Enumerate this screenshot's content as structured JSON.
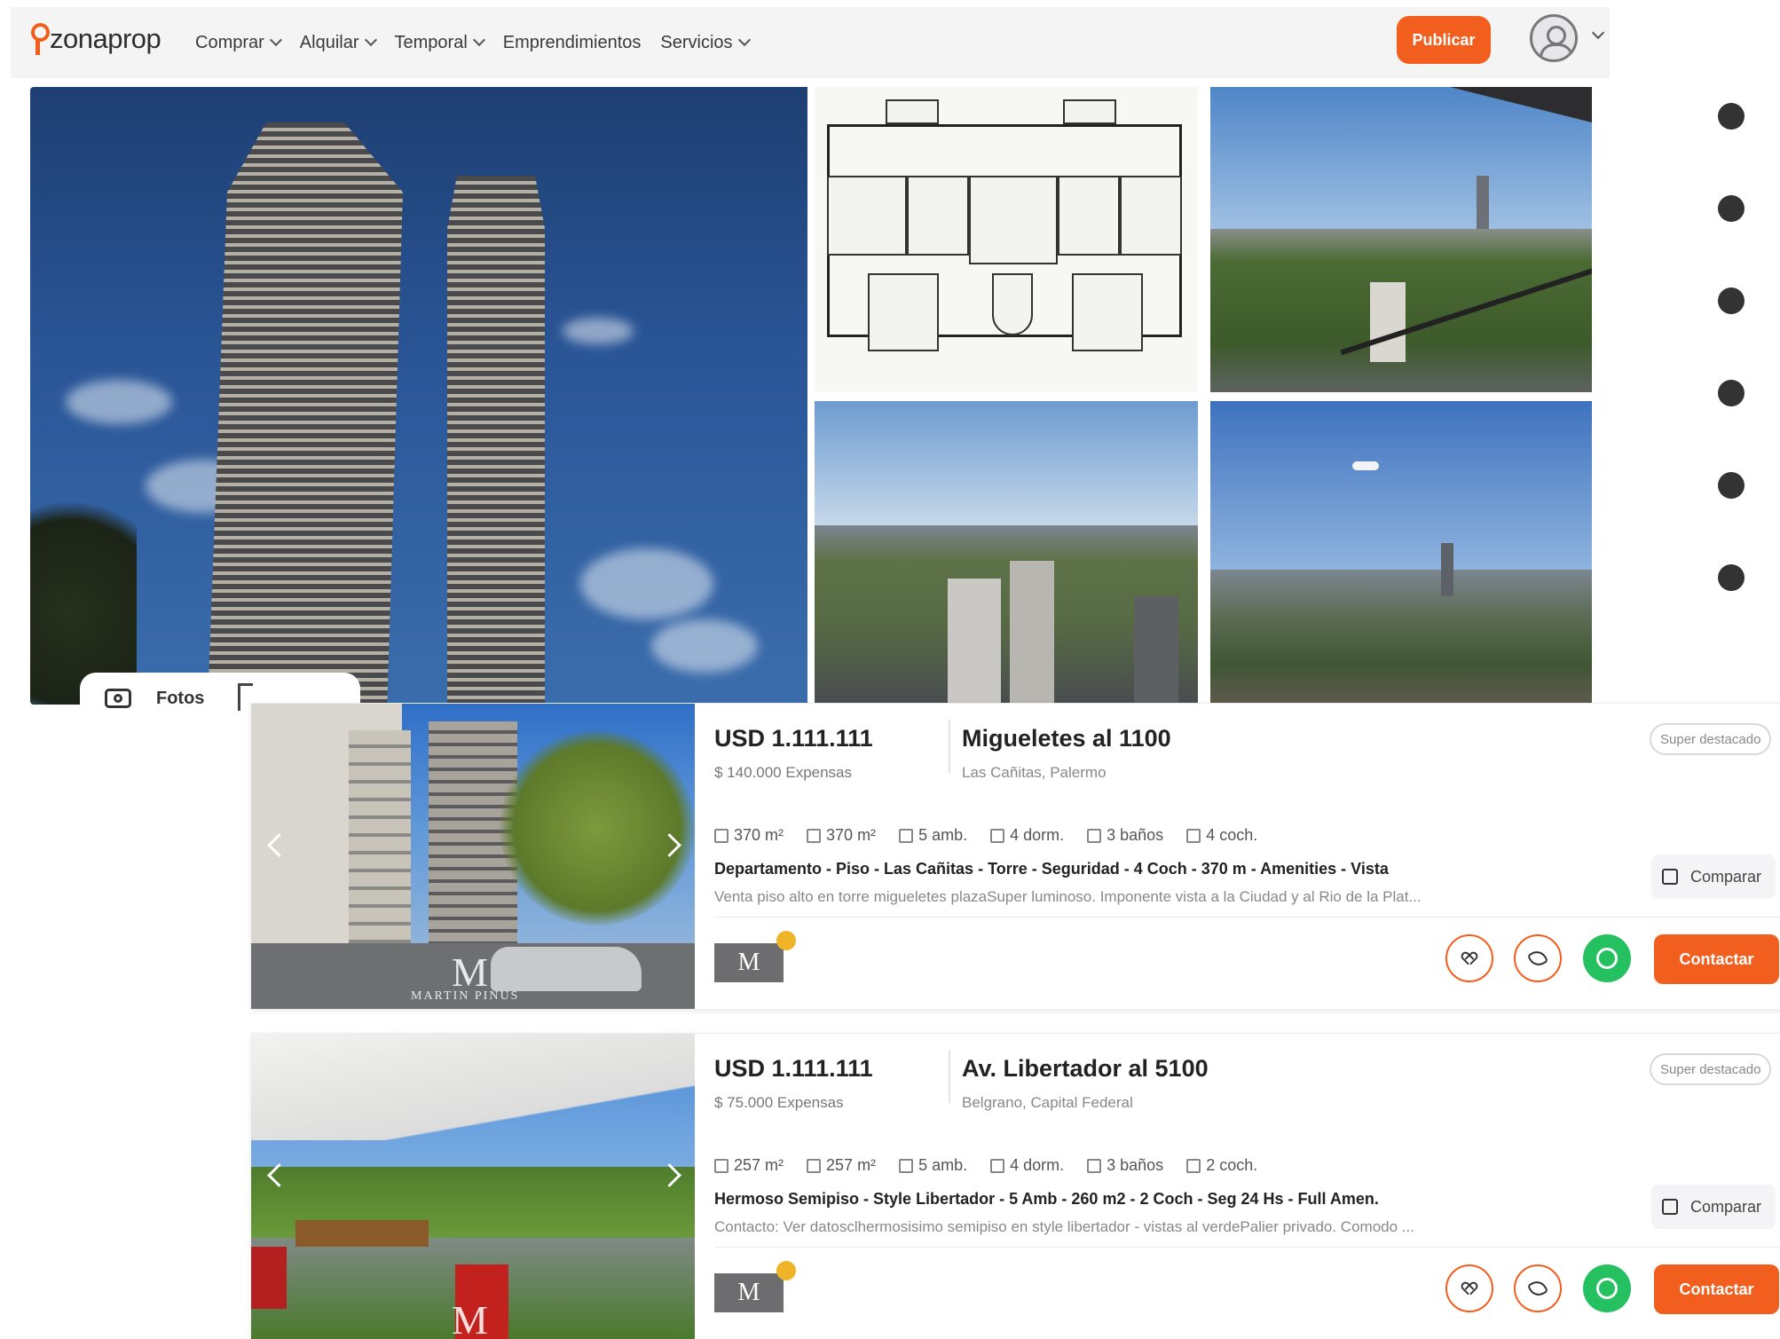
{
  "header": {
    "logo_text": "zonaprop",
    "nav": [
      {
        "label": "Comprar",
        "has_dropdown": true
      },
      {
        "label": "Alquilar",
        "has_dropdown": true
      },
      {
        "label": "Temporal",
        "has_dropdown": true
      },
      {
        "label": "Emprendimientos",
        "has_dropdown": false
      },
      {
        "label": "Servicios",
        "has_dropdown": true
      }
    ],
    "publish_label": "Publicar"
  },
  "gallery": {
    "photos_label": "Fotos",
    "dots_count": 6
  },
  "listings": [
    {
      "price": "USD 1.111.111",
      "expenses": "$ 140.000 Expensas",
      "address": "Migueletes al 1100",
      "location": "Las Cañitas, Palermo",
      "badge": "Super destacado",
      "features": [
        "370 m²",
        "370 m²",
        "5 amb.",
        "4 dorm.",
        "3 baños",
        "4 coch."
      ],
      "headline": "Departamento - Piso - Las Cañitas - Torre - Seguridad - 4 Coch - 370 m - Amenities - Vista",
      "description": "Venta piso alto en torre migueletes plazaSuper luminoso. Imponente vista a la Ciudad y al Rio de la Plat...",
      "compare_label": "Comparar",
      "contact_label": "Contactar",
      "publisher_logo": "M",
      "watermark": "MARTIN PINUS"
    },
    {
      "price": "USD 1.111.111",
      "expenses": "$ 75.000 Expensas",
      "address": "Av. Libertador al 5100",
      "location": "Belgrano, Capital Federal",
      "badge": "Super destacado",
      "features": [
        "257 m²",
        "257 m²",
        "5 amb.",
        "4 dorm.",
        "3 baños",
        "2 coch."
      ],
      "headline": "Hermoso Semipiso - Style Libertador - 5 Amb - 260 m2 - 2 Coch - Seg 24 Hs - Full Amen.",
      "description": "Contacto: Ver datosclhermosisimo semipiso en style libertador - vistas al verdePalier privado. Comodo ...",
      "compare_label": "Comparar",
      "contact_label": "Contactar",
      "publisher_logo": "M",
      "watermark": "M"
    }
  ],
  "colors": {
    "brand_orange": "#f25e1d",
    "whatsapp_green": "#25c160",
    "header_bg": "#f4f4f5"
  }
}
